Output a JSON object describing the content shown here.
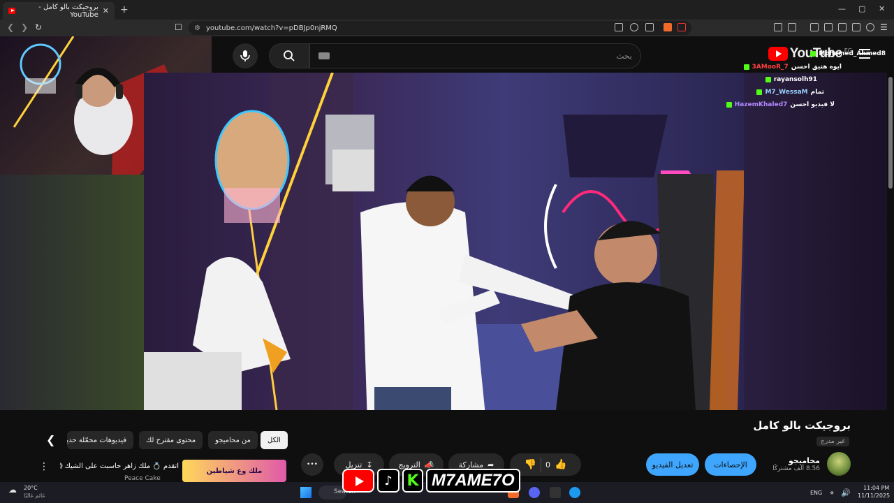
{
  "browser": {
    "tab_title": "بروجيكت بالو كامل - YouTube",
    "tab_close": "✕",
    "new_tab": "+",
    "url": "youtube.com/watch?v=pDBJp0njRMQ",
    "window_controls": [
      "—",
      "▢",
      "✕"
    ]
  },
  "header": {
    "search_placeholder": "بحث",
    "logo_text": "YouTube",
    "region": "EG"
  },
  "chat": {
    "lines": [
      {
        "user": "Mohamed_Ahmed8",
        "msg": "",
        "color": "#53fc18"
      },
      {
        "user": "3AMooR_7",
        "msg": "ايوه هتيق احسن",
        "color": "#ff4040"
      },
      {
        "user": "rayansolh91",
        "msg": "",
        "color": "#ffffff"
      },
      {
        "user": "M7_WessaM",
        "msg": "تمام",
        "color": "#9ad0ff"
      },
      {
        "user": "HazemKhaled7",
        "msg": "لا فيديو احسن",
        "color": "#b088ff"
      }
    ]
  },
  "video": {
    "title": "بروجيكت بالو كامل",
    "privacy": "غير مدرج",
    "channel_name": "محاميجو",
    "subscribers": "8.56 ألف مشتركًا",
    "stats_button": "الإحصاءات",
    "edit_button": "تعديل الفيديو",
    "likes": "0",
    "share": "مشاركة",
    "promote": "الترويج",
    "download": "تنزيل",
    "more": "•••"
  },
  "chips": [
    {
      "label": "الكل",
      "active": true
    },
    {
      "label": "من محاميجو",
      "active": false
    },
    {
      "label": "محتوى مقترح لك",
      "active": false
    },
    {
      "label": "فيديوهات محمّلة حديثًا",
      "active": false
    }
  ],
  "recommendation": {
    "title": "اتقدم 💍 ملك زاهر حاسبت على الشيك 😱",
    "channel": "Peace Cake",
    "thumb_text": "ملك وع شياطين"
  },
  "taskbar": {
    "weather_temp": "20°C",
    "weather_desc": "غائم غالبًا",
    "search_label": "Search",
    "lang": "ENG",
    "time": "11:04 PM",
    "date": "11/11/2025"
  },
  "watermark": {
    "name": "M7AME7O",
    "tiktok_label": "TikTok"
  },
  "colors": {
    "accent_blue": "#3ea6ff",
    "yt_red": "#ff0000",
    "kick_green": "#53fc18"
  }
}
